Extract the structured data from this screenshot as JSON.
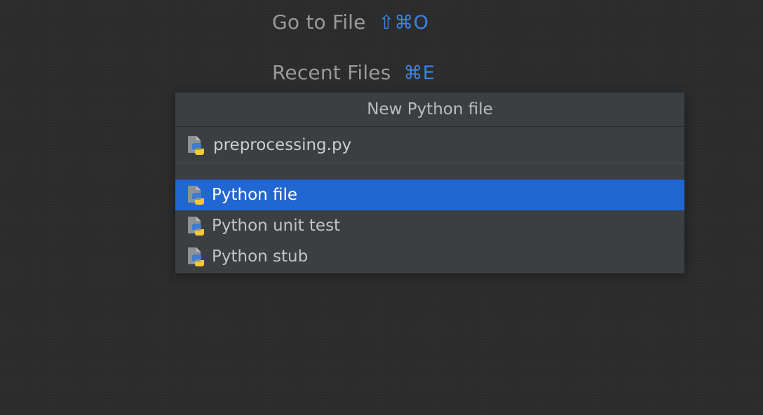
{
  "hints": [
    {
      "label": "Go to File",
      "shortcut": "⇧⌘O"
    },
    {
      "label": "Recent Files",
      "shortcut": "⌘E"
    }
  ],
  "dialog": {
    "title": "New Python file",
    "filename_value": "preprocessing.py",
    "file_icon": "python-file-icon"
  },
  "file_types": [
    {
      "label": "Python file",
      "selected": true,
      "icon": "python-file-icon"
    },
    {
      "label": "Python unit test",
      "selected": false,
      "icon": "python-file-icon"
    },
    {
      "label": "Python stub",
      "selected": false,
      "icon": "python-file-icon"
    }
  ],
  "colors": {
    "background": "#2b2b2b",
    "popup": "#3c3f41",
    "selection": "#2266d2",
    "shortcut": "#3d82e6",
    "hint_text": "#9a9a9a"
  }
}
